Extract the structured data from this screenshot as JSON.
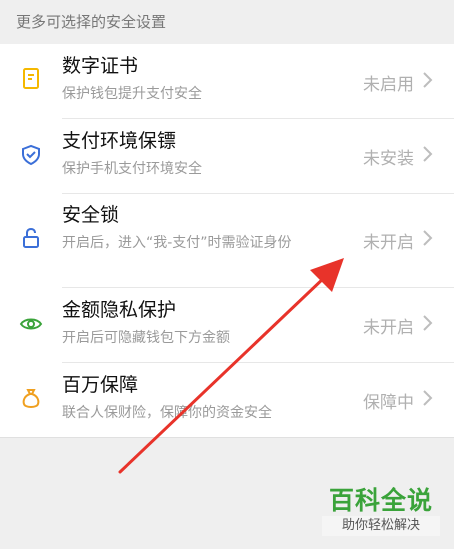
{
  "section_header": "更多可选择的安全设置",
  "items": [
    {
      "title": "数字证书",
      "desc": "保护钱包提升支付安全",
      "status": "未启用",
      "icon": "certificate-icon"
    },
    {
      "title": "支付环境保镖",
      "desc": "保护手机支付环境安全",
      "status": "未安装",
      "icon": "shield-check-icon"
    },
    {
      "title": "安全锁",
      "desc": "开启后，进入“我-支付”时需验证身份",
      "status": "未开启",
      "icon": "lock-icon"
    },
    {
      "title": "金额隐私保护",
      "desc": "开启后可隐藏钱包下方金额",
      "status": "未开启",
      "icon": "eye-icon"
    },
    {
      "title": "百万保障",
      "desc": "联合人保财险，保障你的资金安全",
      "status": "保障中",
      "icon": "money-bag-icon"
    }
  ],
  "watermark": {
    "main": "百科全说",
    "sub": "助你轻松解决"
  },
  "colors": {
    "accent_yellow": "#f5b800",
    "accent_blue": "#3b6fd8",
    "accent_green": "#3aa33a",
    "accent_orange": "#f0a020",
    "arrow_red": "#e8332a"
  }
}
